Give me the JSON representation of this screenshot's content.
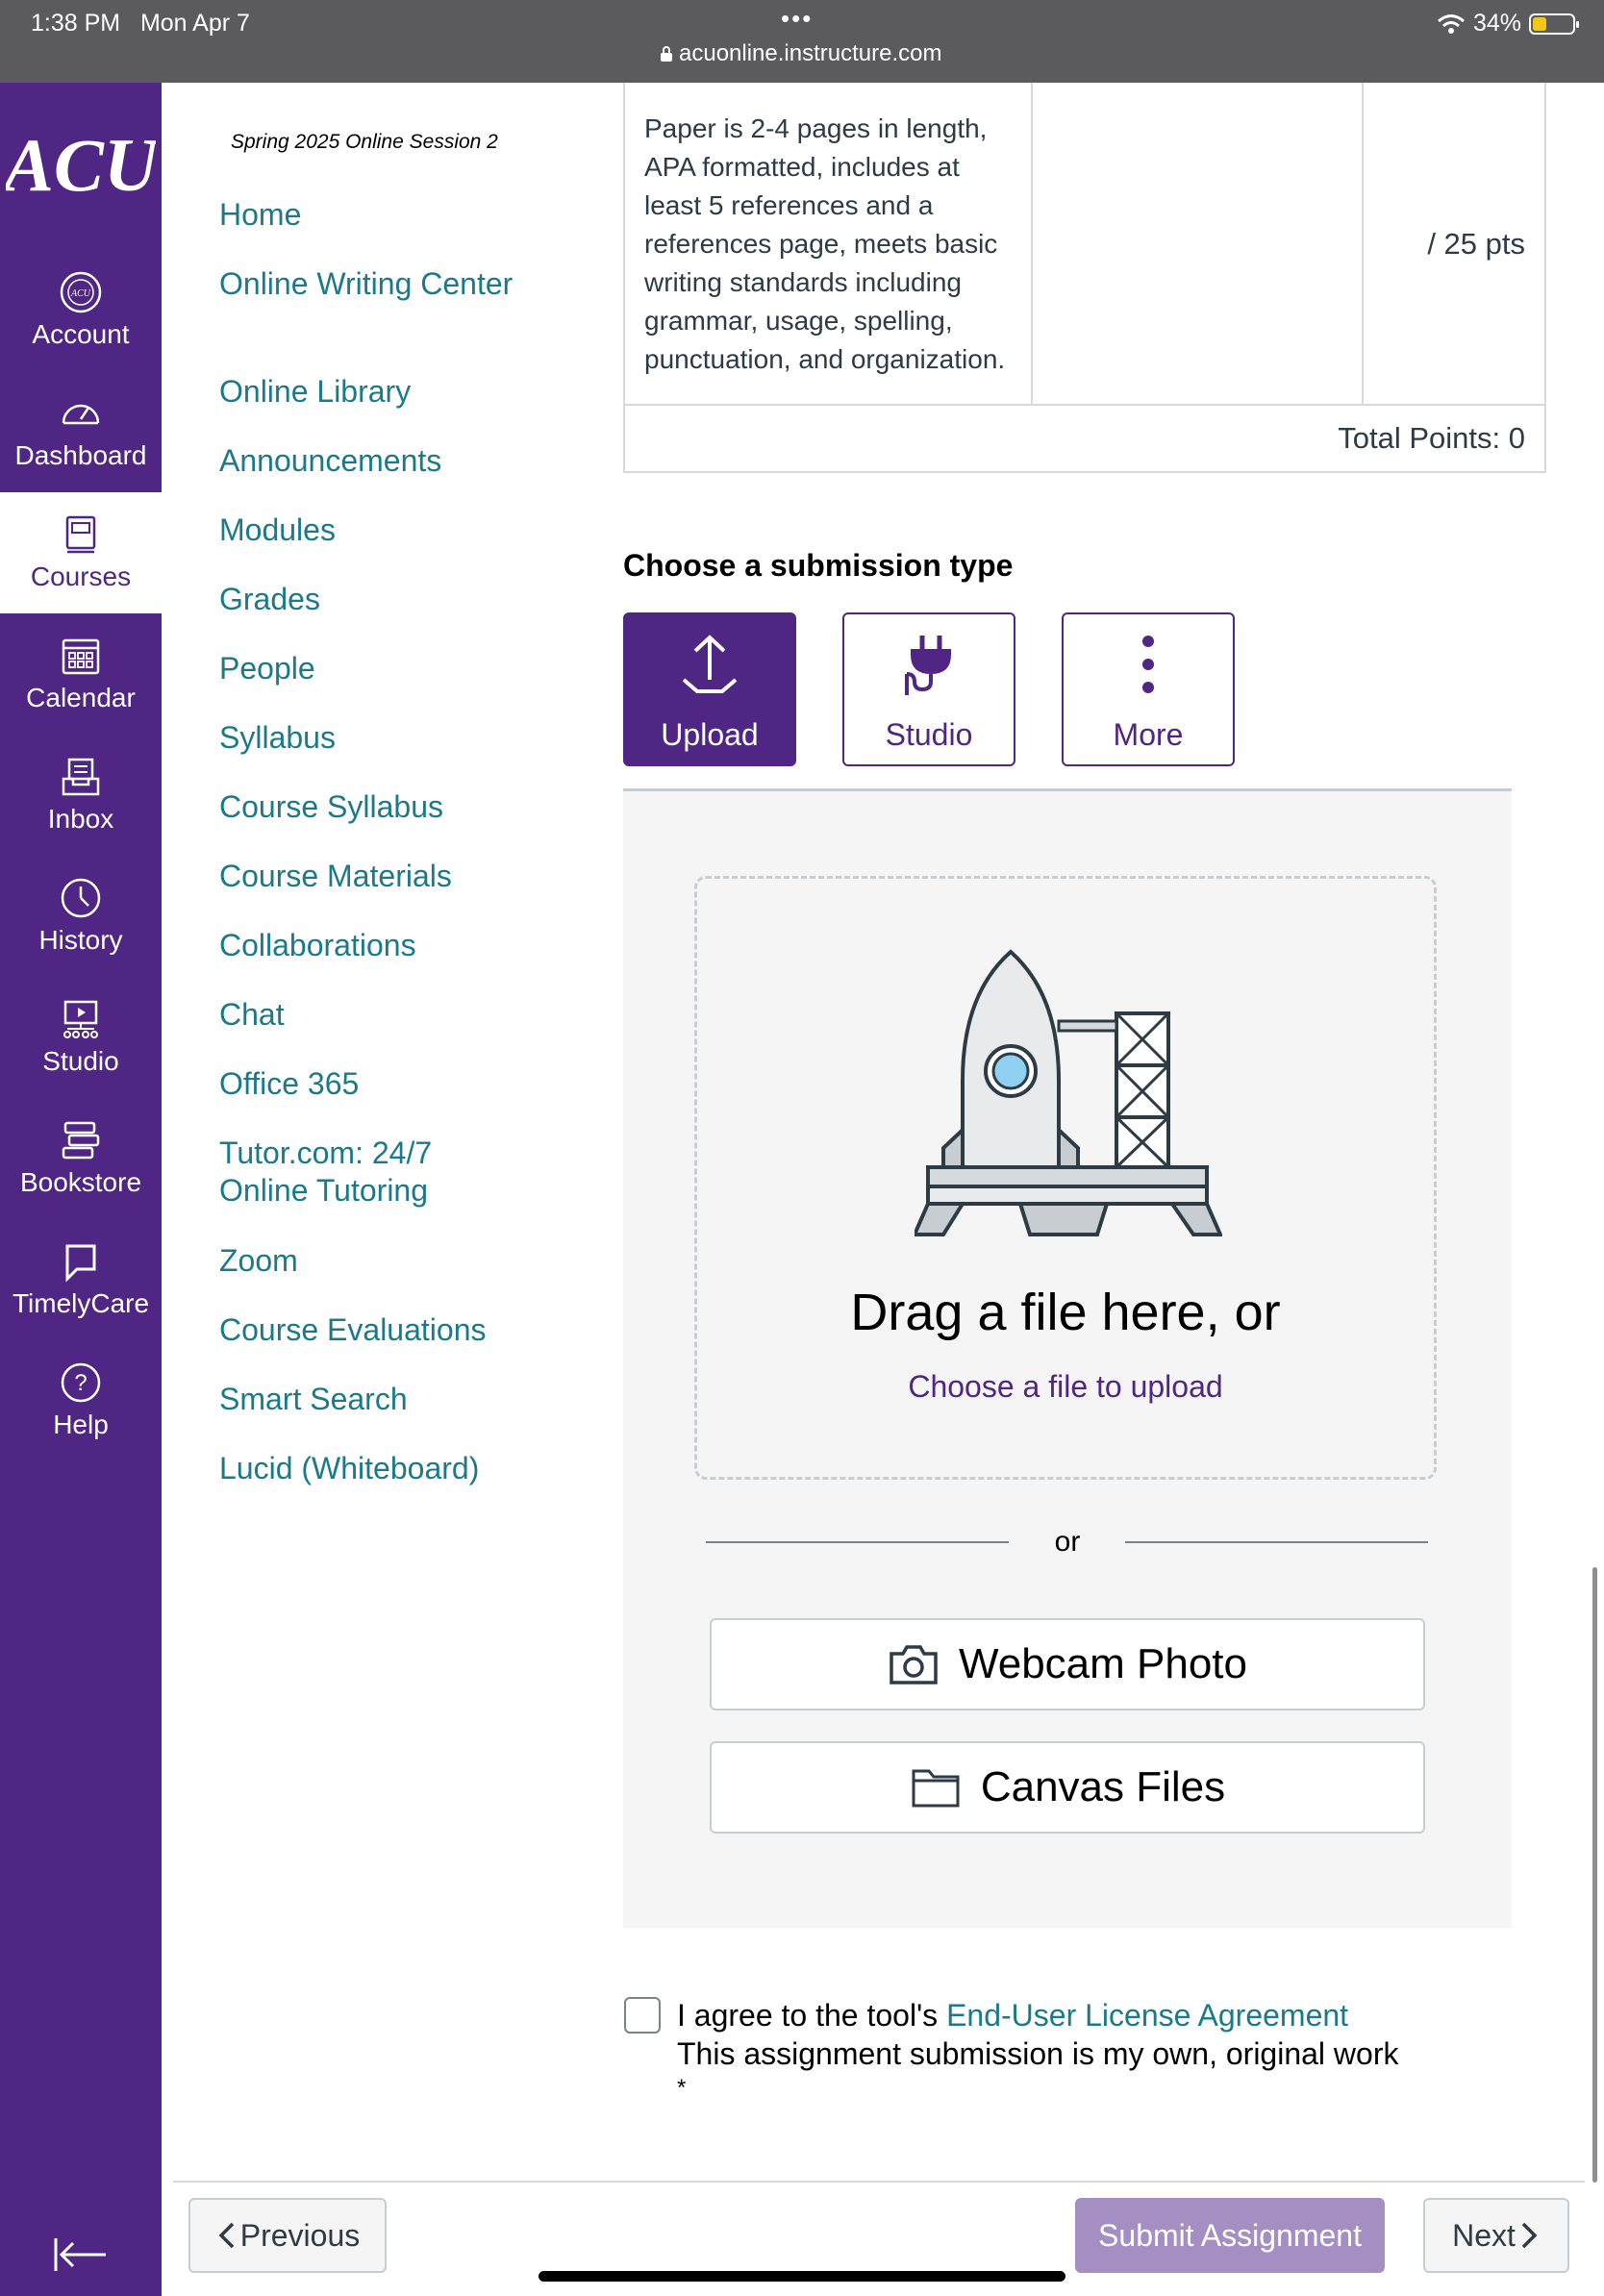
{
  "status_bar": {
    "time": "1:38 PM",
    "date": "Mon Apr 7",
    "url": "acuonline.instructure.com",
    "battery": "34%",
    "battery_level": 0.34
  },
  "global_nav": {
    "logo_text": "ACU",
    "items": [
      {
        "label": "Account",
        "icon": "account-icon"
      },
      {
        "label": "Dashboard",
        "icon": "dashboard-icon"
      },
      {
        "label": "Courses",
        "icon": "courses-icon",
        "active": true
      },
      {
        "label": "Calendar",
        "icon": "calendar-icon"
      },
      {
        "label": "Inbox",
        "icon": "inbox-icon"
      },
      {
        "label": "History",
        "icon": "history-icon"
      },
      {
        "label": "Studio",
        "icon": "studio-icon"
      },
      {
        "label": "Bookstore",
        "icon": "bookstore-icon"
      },
      {
        "label": "TimelyCare",
        "icon": "timelycare-icon"
      },
      {
        "label": "Help",
        "icon": "help-icon"
      }
    ],
    "colors": {
      "brand": "#4f2683",
      "text": "#ffffff"
    }
  },
  "course_nav": {
    "term": "Spring 2025 Online Session 2",
    "links": [
      "Home",
      "Online Writing Center",
      "Online Library",
      "Announcements",
      "Modules",
      "Grades",
      "People",
      "Syllabus",
      "Course Syllabus",
      "Course Materials",
      "Collaborations",
      "Chat",
      "Office 365",
      "Tutor.com: 24/7 Online Tutoring",
      "Zoom",
      "Course Evaluations",
      "Smart Search",
      "Lucid (Whiteboard)"
    ],
    "link_color": "#1a7a8a"
  },
  "rubric": {
    "criterion": "Paper is 2-4 pages in length, APA formatted, includes at least 5 references and a references page, meets basic writing standards including grammar, usage, spelling, punctuation, and organization.",
    "points": "/ 25 pts",
    "total": "Total Points: 0"
  },
  "submission": {
    "heading": "Choose a submission type",
    "types": [
      {
        "label": "Upload",
        "icon": "upload-icon",
        "selected": true
      },
      {
        "label": "Studio",
        "icon": "plug-icon"
      },
      {
        "label": "More",
        "icon": "more-vertical-icon"
      }
    ],
    "drag_text": "Drag a file here, or",
    "choose_file": "Choose a file to upload",
    "or_text": "or",
    "webcam": "Webcam Photo",
    "canvas_files": "Canvas Files"
  },
  "agreement": {
    "prefix": "I agree to the tool's ",
    "link": "End-User License Agreement",
    "own_work": "This assignment submission is my own, original work",
    "required_mark": "*"
  },
  "footer": {
    "previous": "Previous",
    "submit": "Submit Assignment",
    "next": "Next"
  }
}
